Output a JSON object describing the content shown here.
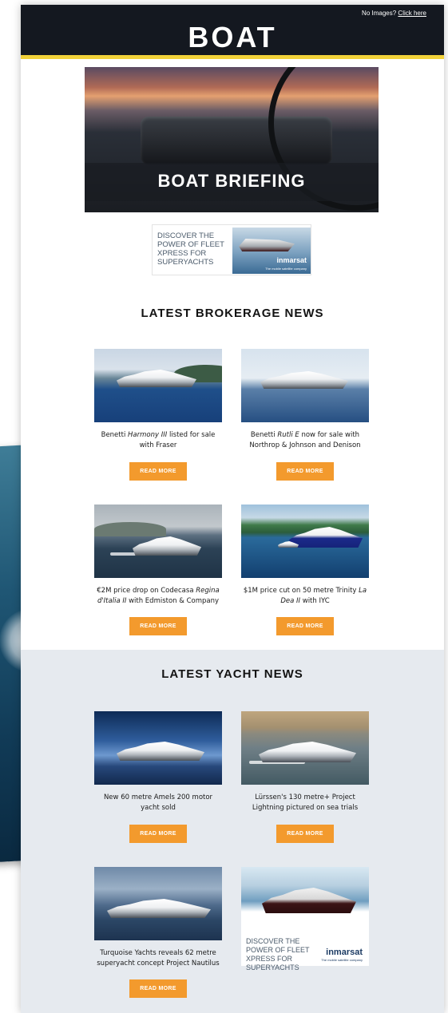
{
  "masthead": {
    "logo": "BOAT",
    "no_images_text": "No Images?",
    "no_images_link": "Click here"
  },
  "hero": {
    "title": "BOAT BRIEFING"
  },
  "top_ad": {
    "copy": "DISCOVER THE POWER OF FLEET XPRESS FOR SUPERYACHTS",
    "brand": "inmarsat",
    "tagline": "The mobile satellite company"
  },
  "brokerage": {
    "heading": "LATEST BROKERAGE NEWS",
    "button_label": "READ MORE",
    "items": [
      {
        "pre": "Benetti ",
        "name": "Harmony III",
        "post": " listed for sale with Fraser"
      },
      {
        "pre": "Benetti ",
        "name": "Rutli E",
        "post": " now for sale with Northrop & Johnson and Denison"
      },
      {
        "pre": "€2M price drop on Codecasa ",
        "name": "Regina d'Italia II",
        "post": " with Edmiston & Company"
      },
      {
        "pre": "$1M price cut on 50 metre Trinity ",
        "name": "La Dea II",
        "post": " with IYC"
      }
    ]
  },
  "yacht_news": {
    "heading": "LATEST YACHT NEWS",
    "button_label": "READ MORE",
    "items": [
      {
        "text": "New 60 metre Amels 200 motor yacht sold"
      },
      {
        "text": "Lürssen's 130 metre+ Project Lightning pictured on sea trials"
      },
      {
        "text": "Turquoise Yachts reveals 62 metre superyacht concept Project Nautilus"
      }
    ],
    "ad": {
      "copy": "DISCOVER THE POWER OF FLEET XPRESS FOR SUPERYACHTS",
      "brand": "inmarsat",
      "tagline": "The mobile satellite company"
    }
  },
  "colors": {
    "masthead_bg": "#141820",
    "accent_bar": "#f2d23a",
    "button": "#f39a2d",
    "section_bg": "#e6eaef"
  }
}
